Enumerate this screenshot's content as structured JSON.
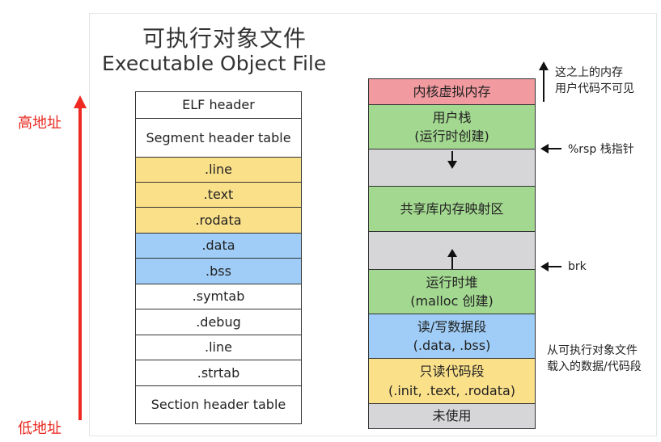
{
  "title": {
    "cn": "可执行对象文件",
    "en": "Executable Object File"
  },
  "axis": {
    "high": "高地址",
    "low": "低地址"
  },
  "elf_sections": [
    {
      "label": ".line",
      "color": "#fbe08a"
    }
  ],
  "elf": {
    "header": "ELF header",
    "segment_header_table": "Segment header table",
    "line1": ".line",
    "text": ".text",
    "rodata": ".rodata",
    "data": ".data",
    "bss": ".bss",
    "symtab": ".symtab",
    "debug": ".debug",
    "line2": ".line",
    "strtab": ".strtab",
    "section_header_table": "Section header table"
  },
  "memory": {
    "kernel": "内核虚拟内存",
    "user_stack": {
      "line1": "用户栈",
      "line2": "(运行时创建)"
    },
    "shared_libs": "共享库内存映射区",
    "heap": {
      "line1": "运行时堆",
      "line2": "(malloc 创建)"
    },
    "rw_segment": {
      "line1": "读/写数据段",
      "line2": "(.data, .bss)"
    },
    "ro_segment": {
      "line1": "只读代码段",
      "line2": "(.init, .text, .rodata)"
    },
    "unused": "未使用"
  },
  "annotations": {
    "above": {
      "line1": "这之上的内存",
      "line2": "用户代码不可见"
    },
    "rsp": "%rsp 栈指针",
    "brk": "brk",
    "from_file": {
      "line1": "从可执行对象文件",
      "line2": "载入的数据/代码段"
    }
  },
  "colors": {
    "code_segment": "#fbe08a",
    "data_segment": "#9fcdf7",
    "kernel": "#f19aa0",
    "user_region": "#a3d890",
    "free_region": "#d6d6d8",
    "address_arrow": "#ee2a22"
  }
}
